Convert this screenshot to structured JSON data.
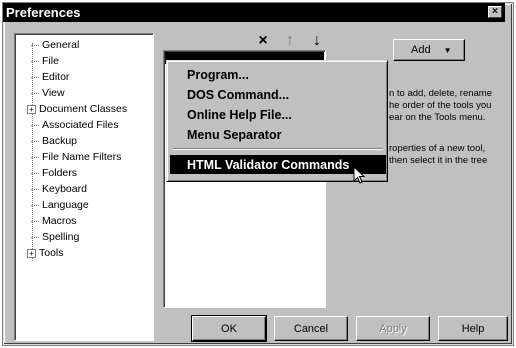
{
  "window": {
    "title": "Preferences",
    "close_glyph": "×"
  },
  "tree": {
    "items": [
      {
        "label": "General",
        "expander": ""
      },
      {
        "label": "File",
        "expander": ""
      },
      {
        "label": "Editor",
        "expander": ""
      },
      {
        "label": "View",
        "expander": ""
      },
      {
        "label": "Document Classes",
        "expander": "+"
      },
      {
        "label": "Associated Files",
        "expander": ""
      },
      {
        "label": "Backup",
        "expander": ""
      },
      {
        "label": "File Name Filters",
        "expander": ""
      },
      {
        "label": "Folders",
        "expander": ""
      },
      {
        "label": "Keyboard",
        "expander": ""
      },
      {
        "label": "Language",
        "expander": ""
      },
      {
        "label": "Macros",
        "expander": ""
      },
      {
        "label": "Spelling",
        "expander": ""
      },
      {
        "label": "Tools",
        "expander": "+"
      }
    ]
  },
  "toolbar": {
    "delete_icon": "×",
    "up_icon": "↑",
    "down_icon": "↓"
  },
  "menu": {
    "items": [
      {
        "label": "Program...",
        "highlighted": false
      },
      {
        "label": "DOS Command...",
        "highlighted": false
      },
      {
        "label": "Online Help File...",
        "highlighted": false
      },
      {
        "label": "Menu Separator",
        "highlighted": false
      },
      {
        "label": "HTML Validator Commands",
        "highlighted": true
      }
    ]
  },
  "add_button": {
    "label": "Add",
    "arrow": "▼"
  },
  "help_text": [
    "n to add, delete, rename",
    "he order of the tools you",
    "ear on the Tools menu.",
    "",
    "roperties of a new tool,",
    "then select it in the tree"
  ],
  "buttons": {
    "ok": "OK",
    "cancel": "Cancel",
    "apply": "Apply",
    "help": "Help"
  },
  "colors": {
    "face": "#c0c0c0",
    "highlight": "#000000",
    "title_bar": "#000000"
  }
}
